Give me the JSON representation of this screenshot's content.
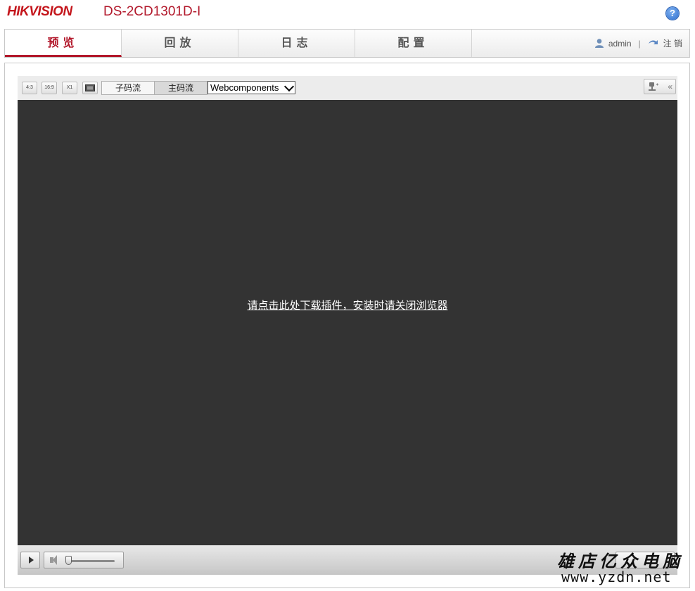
{
  "header": {
    "logo": "HIKVISION",
    "model": "DS-2CD1301D-I",
    "help_symbol": "?"
  },
  "nav": {
    "tabs": [
      {
        "label": "预览",
        "active": true
      },
      {
        "label": "回放",
        "active": false
      },
      {
        "label": "日志",
        "active": false
      },
      {
        "label": "配置",
        "active": false
      }
    ],
    "user": "admin",
    "separator": "|",
    "logout": "注 销"
  },
  "toolbar": {
    "aspect_buttons": [
      {
        "icon": "aspect-4-3-icon",
        "label": "4:3"
      },
      {
        "icon": "aspect-16-9-icon",
        "label": "16:9"
      },
      {
        "icon": "original-size-icon",
        "label": "X1"
      },
      {
        "icon": "auto-fit-icon",
        "label": ""
      }
    ],
    "streams": {
      "sub": "子码流",
      "main": "主码流",
      "selected": "main"
    },
    "plugin_value": "Webcomponents",
    "ptz_toggle": "«"
  },
  "video": {
    "plugin_message": "请点击此处下载插件，安装时请关闭浏览器",
    "background": "#333333"
  },
  "controls": {
    "volume_level": 0.05
  },
  "watermark": {
    "text": "雄店亿众电脑",
    "url": "www.yzdn.net"
  },
  "colors": {
    "brand_red": "#b2182b",
    "accent_blue": "#2d6fcf"
  }
}
